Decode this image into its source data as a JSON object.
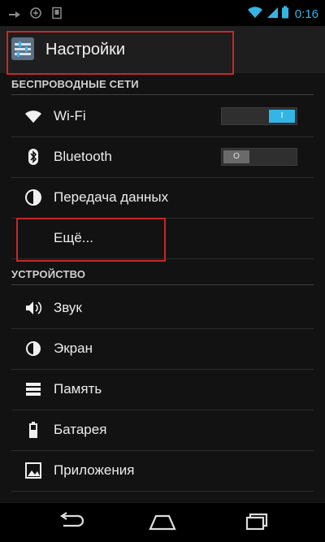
{
  "statusbar": {
    "time": "0:16"
  },
  "actionbar": {
    "title": "Настройки"
  },
  "sections": {
    "wireless": "БЕСПРОВОДНЫЕ СЕТИ",
    "device": "УСТРОЙСТВО"
  },
  "items": {
    "wifi": {
      "label": "Wi-Fi",
      "toggle": "I",
      "state": "on"
    },
    "bluetooth": {
      "label": "Bluetooth",
      "toggle": "O",
      "state": "off"
    },
    "data": {
      "label": "Передача данных"
    },
    "more": {
      "label": "Ещё..."
    },
    "sound": {
      "label": "Звук"
    },
    "screen": {
      "label": "Экран"
    },
    "memory": {
      "label": "Память"
    },
    "battery": {
      "label": "Батарея"
    },
    "apps": {
      "label": "Приложения"
    }
  },
  "colors": {
    "accent": "#33b5e5",
    "highlight": "#c62828"
  }
}
